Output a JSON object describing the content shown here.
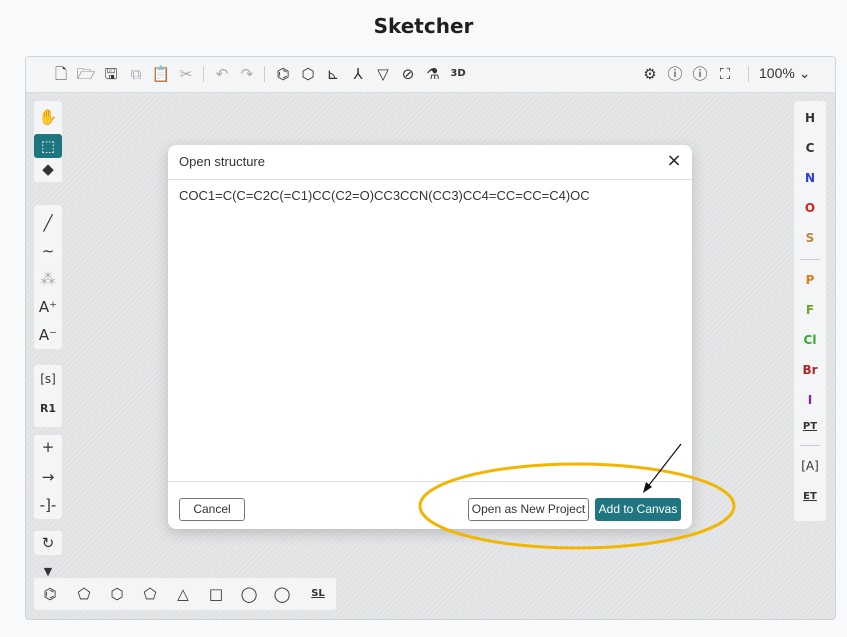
{
  "page": {
    "title": "Sketcher"
  },
  "toolbar": {
    "icons": [
      "new-file-icon",
      "open-file-icon",
      "save-icon",
      "copy-icon",
      "paste-icon",
      "cut-icon",
      "undo-icon",
      "redo-icon",
      "aromatize-icon",
      "clean-icon",
      "layout-icon",
      "stereo-icon",
      "mapping-icon",
      "check-icon",
      "calculate-icon",
      "3d-view-icon",
      "settings-icon",
      "help-icon",
      "info-icon",
      "fullscreen-icon"
    ],
    "zoom_label": "100%"
  },
  "left_tools": [
    "hand-icon",
    "selection-icon",
    "eraser-icon",
    "bond-icon",
    "chain-icon",
    "rgroup-icon",
    "charge-plus-icon",
    "charge-minus-icon",
    "sgroup-icon",
    "rgroup-label-icon",
    "plus-icon",
    "arrow-icon",
    "bracket-icon",
    "rotate-icon",
    "dropdown-icon"
  ],
  "elements": {
    "H": "H",
    "C": "C",
    "N": "N",
    "O": "O",
    "S": "S",
    "P": "P",
    "F": "F",
    "Cl": "Cl",
    "Br": "Br",
    "I": "I",
    "pt": "PT",
    "extended": "ET",
    "colors": {
      "H": "#111111",
      "C": "#111111",
      "N": "#2a3fcf",
      "O": "#d8211b",
      "S": "#b8893a",
      "P": "#e07b1e",
      "F": "#6ba633",
      "Cl": "#2fae2f",
      "Br": "#a52a2a",
      "I": "#8b22a0"
    }
  },
  "bottom_shapes": [
    "benzene-icon",
    "cyclopentadiene-icon",
    "cyclohexane-icon",
    "cyclopentane-icon",
    "cyclopropane-icon",
    "cyclobutane-icon",
    "cycloheptane-icon",
    "cyclooctane-icon",
    "structure-library-icon"
  ],
  "structure_library_label": "SL",
  "dialog": {
    "title": "Open structure",
    "close_label": "×",
    "smiles": "COC1=C(C=C2C(=C1)CC(C2=O)CC3CCN(CC3)CC4=CC=CC=C4)OC",
    "cancel_label": "Cancel",
    "open_new_label": "Open as New Project",
    "add_label": "Add to Canvas"
  },
  "colors": {
    "accent": "#1f7580",
    "highlight": "#f2b600"
  }
}
